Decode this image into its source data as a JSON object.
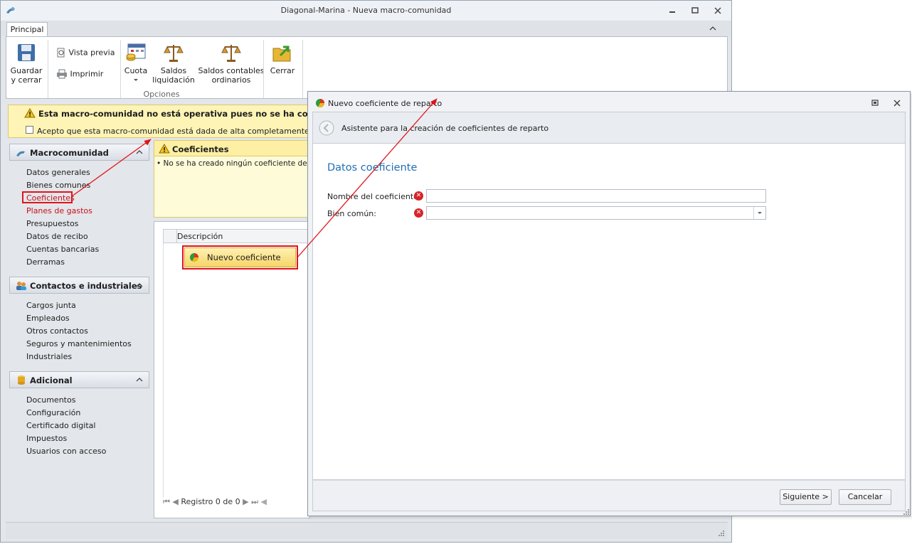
{
  "window": {
    "title": "Diagonal-Marina - Nueva macro-comunidad"
  },
  "ribbon": {
    "tab": "Principal",
    "guardar": [
      "Guardar",
      "y cerrar"
    ],
    "vista_previa": "Vista previa",
    "imprimir": "Imprimir",
    "cuota": "Cuota",
    "saldos_liquidacion": [
      "Saldos",
      "liquidación"
    ],
    "saldos_contables": [
      "Saldos contables",
      "ordinarios"
    ],
    "cerrar": "Cerrar",
    "group_label": "Opciones"
  },
  "warning": {
    "title": "Esta macro-comunidad no está operativa pues no se ha completado",
    "checkbox_text": "Acepto que esta macro-comunidad está dada de alta completamente y a partir de"
  },
  "sidebar": {
    "groups": [
      {
        "title": "Macrocomunidad",
        "items": [
          "Datos generales",
          "Bienes comunes",
          "Coeficientes",
          "Planes de gastos",
          "Presupuestos",
          "Datos de recibo",
          "Cuentas bancarias",
          "Derramas"
        ]
      },
      {
        "title": "Contactos e industriales",
        "items": [
          "Cargos junta",
          "Empleados",
          "Otros contactos",
          "Seguros y mantenimientos",
          "Industriales"
        ]
      },
      {
        "title": "Adicional",
        "items": [
          "Documentos",
          "Configuración",
          "Certificado digital",
          "Impuestos",
          "Usuarios con acceso"
        ]
      }
    ]
  },
  "coef_panel": {
    "title": "Coeficientes",
    "message": "• No se ha creado ningún coeficiente de reparto"
  },
  "grid": {
    "column": "Descripción",
    "new_button": "Nuevo coeficiente",
    "pager": "Registro 0 de 0"
  },
  "dialog": {
    "title": "Nuevo coeficiente de reparto",
    "wizard_header": "Asistente para la creación de coeficientes de reparto",
    "section_title": "Datos coeficiente",
    "fields": {
      "name_label": "Nombre del coeficiente:",
      "name_value": "",
      "bien_label": "Bien común:",
      "bien_value": ""
    },
    "next_button": "Siguiente >",
    "cancel_button": "Cancelar"
  },
  "colors": {
    "accent_red": "#e0141b",
    "warning_bg": "#fdf4b5",
    "section_title": "#1f6fb5",
    "active_link": "#c8101b"
  }
}
